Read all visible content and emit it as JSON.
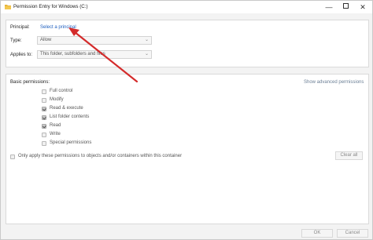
{
  "window": {
    "title": "Permission Entry for Windows (C:)",
    "minimize": "—",
    "close": "✕"
  },
  "principal": {
    "label": "Principal:",
    "link": "Select a principal"
  },
  "type": {
    "label": "Type:",
    "value": "Allow"
  },
  "applies_to": {
    "label": "Applies to:",
    "value": "This folder, subfolders and files"
  },
  "basic_permissions": {
    "heading": "Basic permissions:",
    "advanced_link": "Show advanced permissions",
    "items": [
      {
        "label": "Full control",
        "checked": false
      },
      {
        "label": "Modify",
        "checked": false
      },
      {
        "label": "Read & execute",
        "checked": true
      },
      {
        "label": "List folder contents",
        "checked": true
      },
      {
        "label": "Read",
        "checked": true
      },
      {
        "label": "Write",
        "checked": false
      },
      {
        "label": "Special permissions",
        "checked": false
      }
    ]
  },
  "only_apply": {
    "label": "Only apply these permissions to objects and/or containers within this container",
    "checked": false
  },
  "buttons": {
    "clear_all": "Clear all",
    "ok": "OK",
    "cancel": "Cancel"
  },
  "annotation": {
    "arrow_color": "#d42b2b"
  }
}
